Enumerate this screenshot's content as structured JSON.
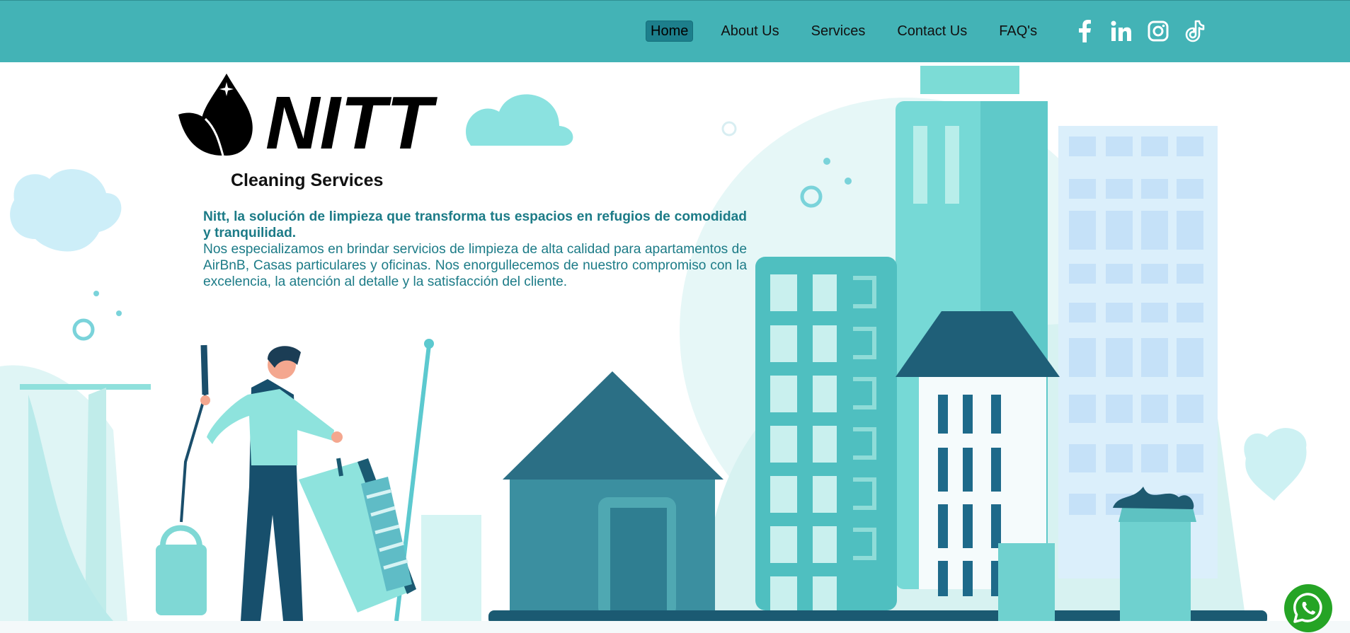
{
  "nav": {
    "items": [
      {
        "label": "Home",
        "active": true
      },
      {
        "label": "About Us",
        "active": false
      },
      {
        "label": "Services",
        "active": false
      },
      {
        "label": "Contact Us",
        "active": false
      },
      {
        "label": "FAQ's",
        "active": false
      }
    ],
    "social": [
      "facebook-icon",
      "linkedin-icon",
      "instagram-icon",
      "tiktok-icon"
    ]
  },
  "hero": {
    "brand": "NITT",
    "subtitle": "Cleaning Services",
    "lead": "Nitt, la solución de limpieza que transforma tus espacios en refugios de comodidad y tranquilidad.",
    "body": "Nos especializamos en brindar servicios de limpieza de alta calidad para apartamentos de AirBnB, Casas particulares y oficinas. Nos enorgullecemos de nuestro compromiso con la excelencia, la atención al detalle y la satisfacción del cliente."
  },
  "colors": {
    "navbar": "#43b3b6",
    "active_nav": "#1d7f8c",
    "text_teal": "#1c7b87",
    "whatsapp": "#25a425"
  },
  "floating": {
    "whatsapp": "whatsapp-icon"
  }
}
